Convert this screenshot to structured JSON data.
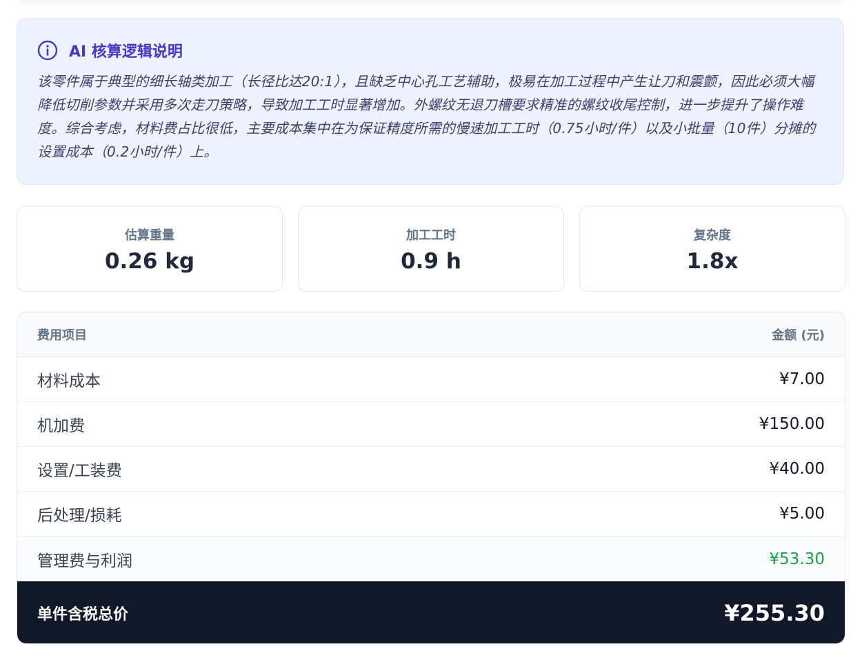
{
  "ai_explanation": {
    "title": "AI 核算逻辑说明",
    "icon": "info-icon",
    "text": "该零件属于典型的细长轴类加工（长径比达20:1），且缺乏中心孔工艺辅助，极易在加工过程中产生让刀和震颤，因此必须大幅降低切削参数并采用多次走刀策略，导致加工工时显著增加。外螺纹无退刀槽要求精准的螺纹收尾控制，进一步提升了操作难度。综合考虑，材料费占比很低，主要成本集中在为保证精度所需的慢速加工工时（0.75小时/件）以及小批量（10件）分摊的设置成本（0.2小时/件）上。"
  },
  "stats": [
    {
      "label": "估算重量",
      "value": "0.26 kg"
    },
    {
      "label": "加工工时",
      "value": "0.9 h"
    },
    {
      "label": "复杂度",
      "value": "1.8x"
    }
  ],
  "cost_table": {
    "headers": {
      "item": "费用项目",
      "amount": "金额 (元)"
    },
    "rows": [
      {
        "label": "材料成本",
        "amount": "¥7.00"
      },
      {
        "label": "机加费",
        "amount": "¥150.00"
      },
      {
        "label": "设置/工装费",
        "amount": "¥40.00"
      },
      {
        "label": "后处理/损耗",
        "amount": "¥5.00"
      },
      {
        "label": "管理费与利润",
        "amount": "¥53.30"
      }
    ],
    "total": {
      "label": "单件含税总价",
      "amount": "¥255.30"
    }
  },
  "colors": {
    "accent": "#4338ca",
    "profit": "#16a34a",
    "total_bg": "#111827"
  }
}
